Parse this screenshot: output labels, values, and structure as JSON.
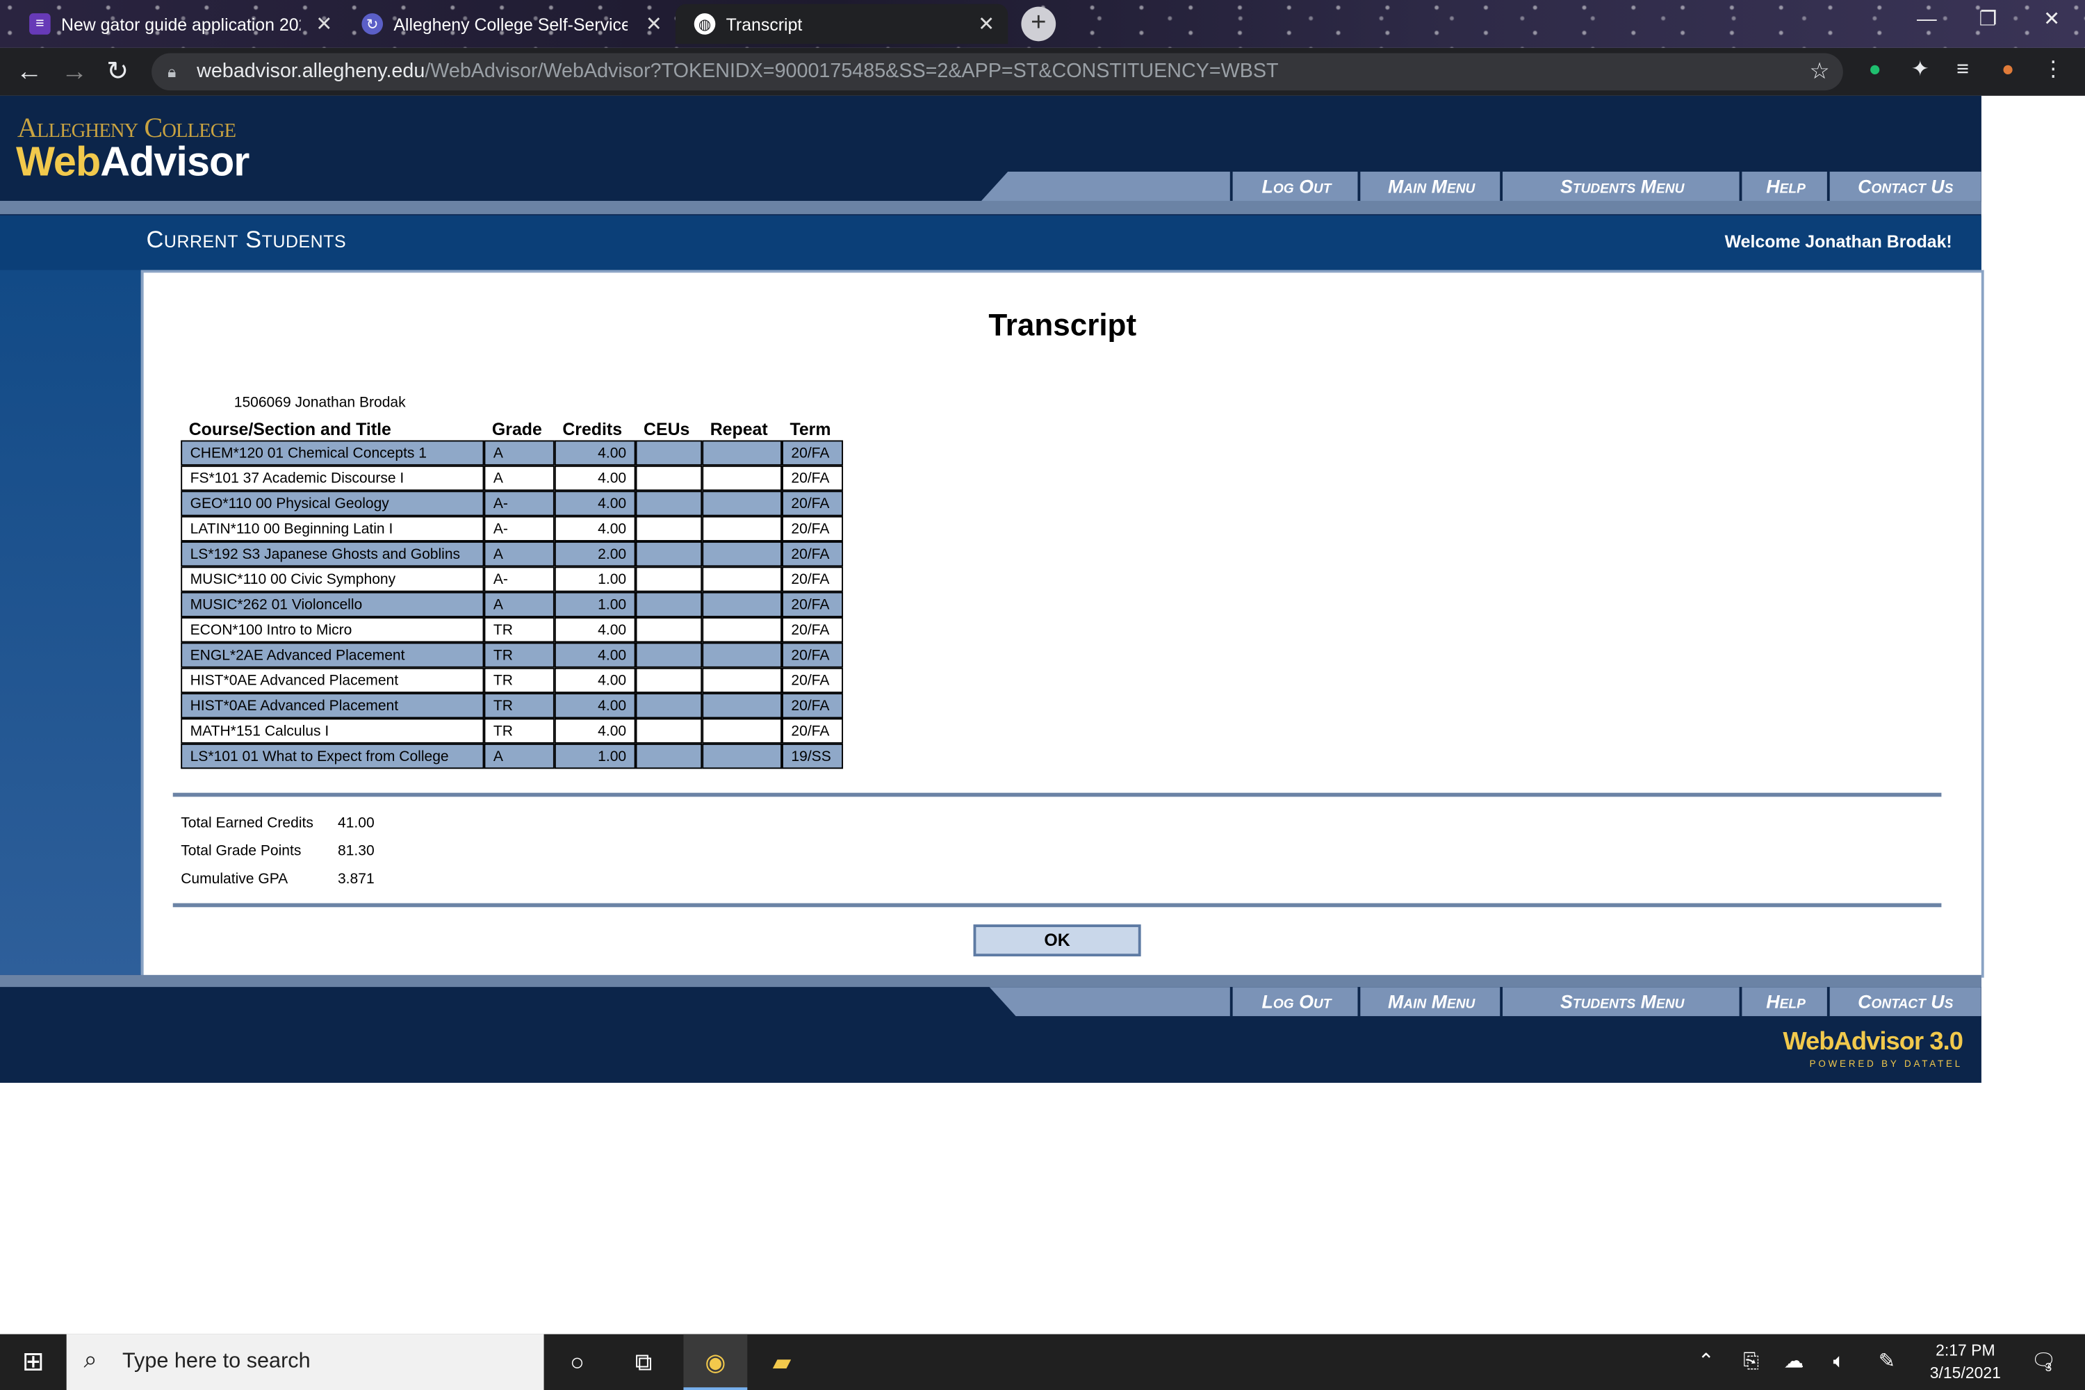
{
  "browser": {
    "tabs": [
      {
        "title": "New gator guide application 202...",
        "icon": "forms-icon",
        "color": "#673ab7"
      },
      {
        "title": "Allegheny College Self-Service",
        "icon": "selfservice-icon",
        "color": "#5b5fc7"
      },
      {
        "title": "Transcript",
        "icon": "globe-icon",
        "color": "#ffffff"
      }
    ],
    "url_host": "webadvisor.allegheny.edu",
    "url_path": "/WebAdvisor/WebAdvisor?TOKENIDX=9000175485&SS=2&APP=ST&CONSTITUENCY=WBST"
  },
  "site": {
    "logo_college": "Allegheny College",
    "logo_web": "Web",
    "logo_advisor": "Advisor",
    "nav": [
      "Log Out",
      "Main Menu",
      "Students Menu",
      "Help",
      "Contact Us"
    ],
    "section_title": "Current Students",
    "welcome": "Welcome Jonathan Brodak!",
    "footer_brand": "WebAdvisor 3.0",
    "footer_powered": "POWERED BY DATATEL"
  },
  "transcript": {
    "title": "Transcript",
    "student": "1506069 Jonathan Brodak",
    "columns": [
      "Course/Section and Title",
      "Grade",
      "Credits",
      "CEUs",
      "Repeat",
      "Term"
    ],
    "rows": [
      [
        "CHEM*120 01 Chemical Concepts 1",
        "A",
        "4.00",
        "",
        "",
        "20/FA"
      ],
      [
        "FS*101 37 Academic Discourse I",
        "A",
        "4.00",
        "",
        "",
        "20/FA"
      ],
      [
        "GEO*110 00 Physical Geology",
        "A-",
        "4.00",
        "",
        "",
        "20/FA"
      ],
      [
        "LATIN*110 00 Beginning Latin I",
        "A-",
        "4.00",
        "",
        "",
        "20/FA"
      ],
      [
        "LS*192 S3 Japanese Ghosts and Goblins",
        "A",
        "2.00",
        "",
        "",
        "20/FA"
      ],
      [
        "MUSIC*110 00 Civic Symphony",
        "A-",
        "1.00",
        "",
        "",
        "20/FA"
      ],
      [
        "MUSIC*262 01 Violoncello",
        "A",
        "1.00",
        "",
        "",
        "20/FA"
      ],
      [
        "ECON*100 Intro to Micro",
        "TR",
        "4.00",
        "",
        "",
        "20/FA"
      ],
      [
        "ENGL*2AE Advanced Placement",
        "TR",
        "4.00",
        "",
        "",
        "20/FA"
      ],
      [
        "HIST*0AE Advanced Placement",
        "TR",
        "4.00",
        "",
        "",
        "20/FA"
      ],
      [
        "HIST*0AE Advanced Placement",
        "TR",
        "4.00",
        "",
        "",
        "20/FA"
      ],
      [
        "MATH*151 Calculus I",
        "TR",
        "4.00",
        "",
        "",
        "20/FA"
      ],
      [
        "LS*101 01 What to Expect from College",
        "A",
        "1.00",
        "",
        "",
        "19/SS"
      ]
    ],
    "totals": [
      {
        "label": "Total Earned Credits",
        "value": "41.00"
      },
      {
        "label": "Total Grade Points",
        "value": "81.30"
      },
      {
        "label": "Cumulative GPA",
        "value": "3.871"
      }
    ],
    "ok_label": "OK"
  },
  "taskbar": {
    "search_placeholder": "Type here to search",
    "time": "2:17 PM",
    "date": "3/15/2021",
    "notification_count": "3"
  }
}
